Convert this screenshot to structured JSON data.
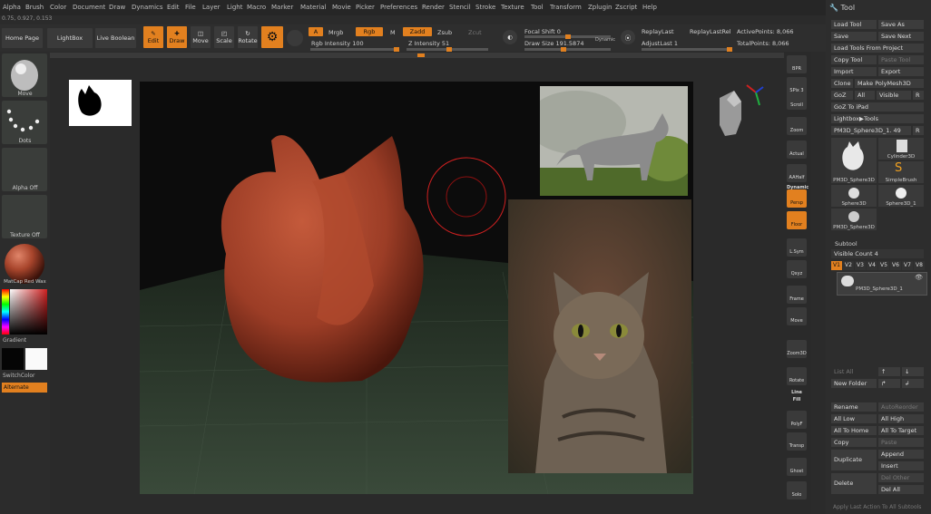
{
  "menu": [
    "Alpha",
    "Brush",
    "Color",
    "Document",
    "Draw",
    "Dynamics",
    "Edit",
    "File",
    "Layer",
    "Light",
    "Macro",
    "Marker",
    "Material",
    "Movie",
    "Picker",
    "Preferences",
    "Render",
    "Stencil",
    "Stroke",
    "Texture",
    "Tool",
    "Transform",
    "Zplugin",
    "Zscript",
    "Help"
  ],
  "coords": "0.75, 0.927, 0.153",
  "top": {
    "home_page": "Home Page",
    "lightbox": "LightBox",
    "live_boolean": "Live Boolean",
    "edit": "Edit",
    "draw": "Draw",
    "move": "Move",
    "scale": "Scale",
    "rotate": "Rotate",
    "a_label": "A",
    "mrgb": "Mrgb",
    "rgb": "Rgb",
    "m": "M",
    "rgb_intensity": "Rgb Intensity 100",
    "zadd": "Zadd",
    "zsub": "Zsub",
    "zcut": "Zcut",
    "z_intensity": "Z Intensity 51",
    "focal_shift": "Focal Shift 0",
    "draw_size": "Draw Size 191.5874",
    "dynamic": "Dynamic",
    "replay_last": "ReplayLast",
    "replay_last_rel": "ReplayLastRel",
    "adjust_last": "AdjustLast 1",
    "active_points": "ActivePoints: 8,066",
    "total_points": "TotalPoints: 8,066"
  },
  "left": {
    "move": "Move",
    "dots": "Dots",
    "alpha_off": "Alpha Off",
    "texture_off": "Texture Off",
    "matcap": "MatCap Red Wax",
    "gradient": "Gradient",
    "switch_color": "SwitchColor",
    "alternate": "Alternate"
  },
  "right_strip": [
    "BPR",
    "SPix 3",
    "Scroll",
    "Zoom",
    "Actual",
    "AAHalf",
    "Dynamic",
    "Persp",
    "Floor",
    "L.Sym",
    "Qxyz",
    "Frame",
    "Move",
    "Zoom3D",
    "Rotate",
    "Line Fill",
    "PolyF",
    "Transp",
    "Ghost",
    "Solo"
  ],
  "tool": {
    "title": "Tool",
    "load_tool": "Load Tool",
    "save_as": "Save As",
    "save": "Save",
    "save_next": "Save Next",
    "load_tools_from_project": "Load Tools From Project",
    "copy_tool": "Copy Tool",
    "paste_tool": "Paste Tool",
    "import": "Import",
    "export": "Export",
    "clone": "Clone",
    "make_polymesh": "Make PolyMesh3D",
    "goz": "GoZ",
    "all": "All",
    "visible": "Visible",
    "r": "R",
    "goz_to_ipad": "GoZ To iPad",
    "lightbox_tools": "Lightbox▶Tools",
    "current_tool": "PM3D_Sphere3D_1. 49",
    "thumbs": [
      "PM3D_Sphere3D",
      "Cylinder3D",
      "SimpleBrush",
      "Sphere3D",
      "Sphere3D_1",
      "PM3D_Sphere3D"
    ],
    "subtool": "Subtool",
    "visible_count": "Visible Count 4",
    "v_tabs": [
      "V1",
      "V2",
      "V3",
      "V4",
      "V5",
      "V6",
      "V7",
      "V8"
    ],
    "subtool_name": "PM3D_Sphere3D_1",
    "list_all": "List All",
    "new_folder": "New Folder",
    "rename": "Rename",
    "auto_reorder": "AutoReorder",
    "all_low": "All Low",
    "all_high": "All High",
    "all_to_home": "All To Home",
    "all_to_target": "All To Target",
    "copy": "Copy",
    "paste": "Paste",
    "duplicate": "Duplicate",
    "append": "Append",
    "insert": "Insert",
    "delete": "Delete",
    "del_other": "Del Other",
    "del_all": "Del All",
    "apply_last": "Apply Last Action To All Subtools"
  },
  "colors": {
    "accent": "#e2801f",
    "model": "#a8452c",
    "floor": "#2c3a2c"
  }
}
